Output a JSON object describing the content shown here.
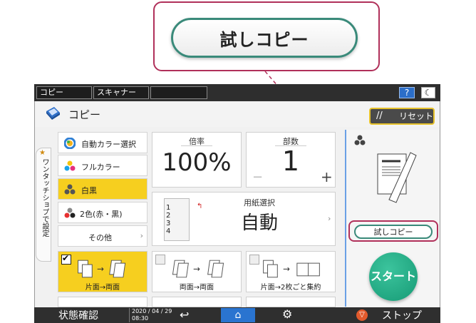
{
  "callout": {
    "button_label": "試しコピー"
  },
  "topbar": {
    "tabs": [
      "コピー",
      "スキャナー",
      ""
    ],
    "help": "?",
    "moon": "☾"
  },
  "header": {
    "title": "コピー",
    "reset": "リセット"
  },
  "side_tab": {
    "label": "ワンタッチショプで設定"
  },
  "color_buttons": [
    {
      "label": "自動カラー選択"
    },
    {
      "label": "フルカラー"
    },
    {
      "label": "白黒",
      "selected": true
    },
    {
      "label": "2色(赤・黒)"
    },
    {
      "label": "その他"
    }
  ],
  "ratio": {
    "label": "倍率",
    "value": "100%"
  },
  "copies": {
    "label": "部数",
    "value": "1",
    "minus": "−",
    "plus": "+"
  },
  "paper": {
    "label": "用紙選択",
    "value": "自動",
    "trays": [
      "1",
      "2",
      "3",
      "4"
    ]
  },
  "duplex": [
    {
      "label": "片面→両面",
      "checked": true
    },
    {
      "label": "両面→両面",
      "checked": false
    },
    {
      "label": "片面→2枚ごと集約",
      "checked": false
    }
  ],
  "right_panel": {
    "trial_copy": "試しコピー",
    "start": "スタート"
  },
  "bottombar": {
    "status": "状態確認",
    "date": "2020 / 04 / 29",
    "time": "08:30",
    "stop": "ストップ"
  },
  "colors": {
    "accent_yellow": "#f6cf1f",
    "start_green": "#1fa880",
    "callout_magenta": "#b0305a",
    "topbar_dark": "#2e2e2e"
  }
}
